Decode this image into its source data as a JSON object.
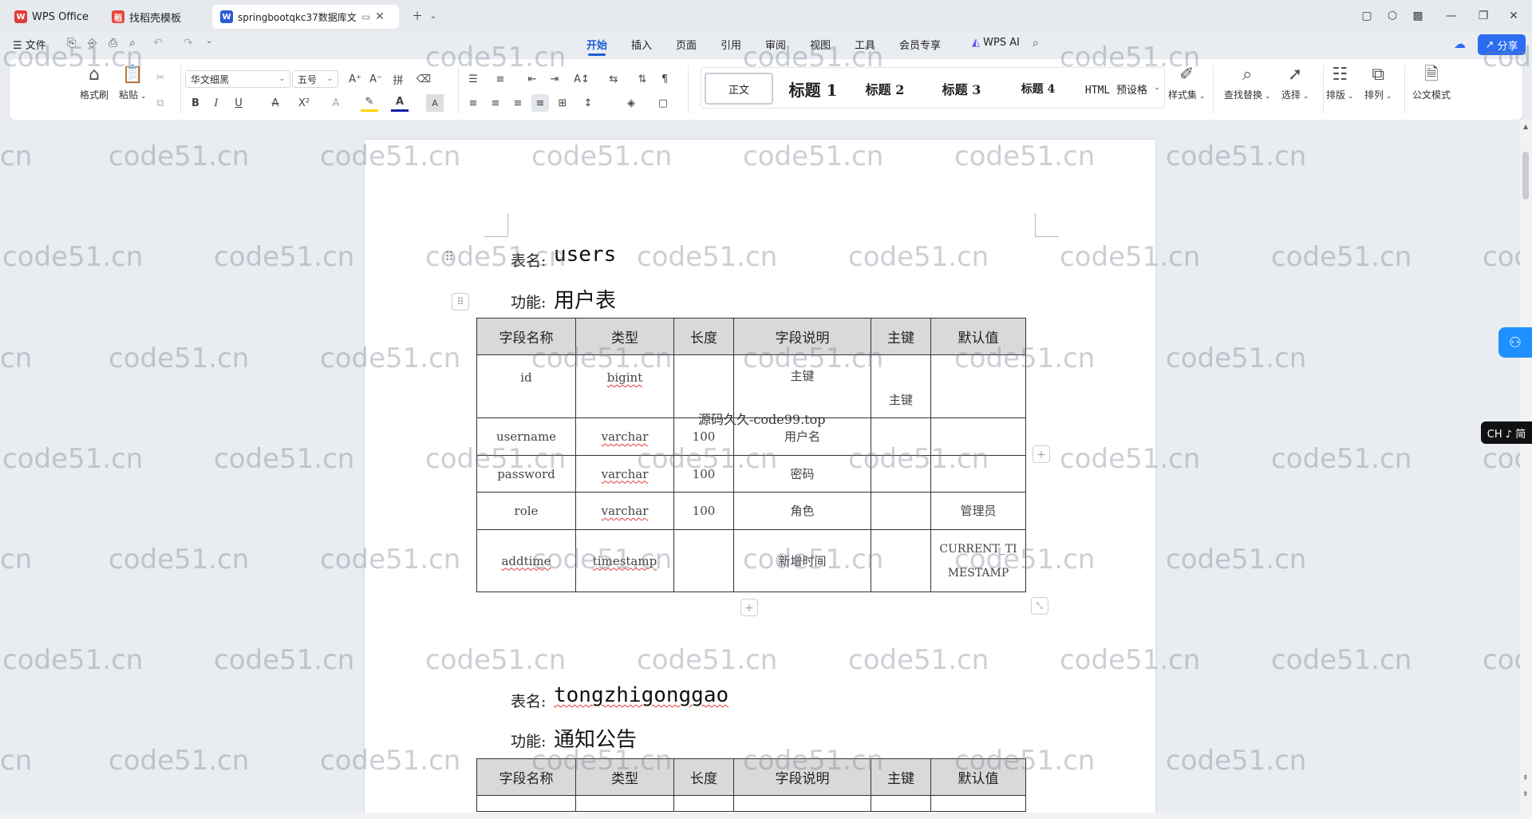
{
  "tabs": [
    {
      "label": "WPS Office",
      "icon": "wps-logo-icon"
    },
    {
      "label": "找稻壳模板",
      "icon": "docer-icon"
    },
    {
      "label": "springbootqkc37数据库文",
      "icon": "word-doc-icon"
    }
  ],
  "menu": {
    "file": "文件",
    "items": [
      "开始",
      "插入",
      "页面",
      "引用",
      "审阅",
      "视图",
      "工具",
      "会员专享"
    ],
    "wps_ai": "WPS AI",
    "share": "分享"
  },
  "ribbon": {
    "format_painter": "格式刷",
    "paste": "粘贴",
    "font_name": "华文细黑",
    "font_size": "五号",
    "styles": [
      "正文",
      "标题 1",
      "标题 2",
      "标题 3",
      "标题 4",
      "HTML 预设格"
    ],
    "style_set": "样式集",
    "find_replace": "查找替换",
    "select": "选择",
    "layout": "排版",
    "arrange": "排列",
    "official_mode": "公文模式"
  },
  "doc": {
    "table_name_label": "表名:",
    "function_label": "功能:",
    "table1": {
      "name": "users",
      "function": "用户表",
      "headers": [
        "字段名称",
        "类型",
        "长度",
        "字段说明",
        "主键",
        "默认值"
      ],
      "rows": [
        {
          "field": "id",
          "type": "bigint",
          "length": "",
          "desc": "主键",
          "pk": "主键",
          "default": ""
        },
        {
          "field": "username",
          "type": "varchar",
          "length": "100",
          "desc": "用户名",
          "pk": "",
          "default": ""
        },
        {
          "field": "password",
          "type": "varchar",
          "length": "100",
          "desc": "密码",
          "pk": "",
          "default": ""
        },
        {
          "field": "role",
          "type": "varchar",
          "length": "100",
          "desc": "角色",
          "pk": "",
          "default": "管理员"
        },
        {
          "field": "addtime",
          "type": "timestamp",
          "length": "",
          "desc": "新增时间",
          "pk": "",
          "default": "CURRENT_TIMESTAMP"
        }
      ]
    },
    "table2": {
      "name": "tongzhigonggao",
      "function": "通知公告",
      "headers": [
        "字段名称",
        "类型",
        "长度",
        "字段说明",
        "主键",
        "默认值"
      ]
    },
    "center_watermark": "源码久久-code99.top",
    "watermark": "code51.cn",
    "watermark_partial_left": "cn",
    "watermark_partial_right": "cod"
  },
  "ime": "CH ♪ 简",
  "colors": {
    "accent": "#1f5dd6",
    "share": "#2b6cf2",
    "float": "#1e90ff"
  }
}
